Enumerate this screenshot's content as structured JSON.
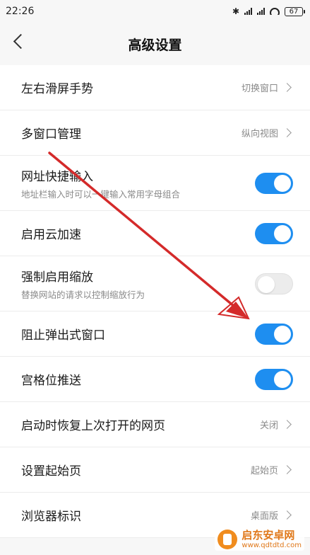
{
  "status_bar": {
    "time": "22:26",
    "battery": "67"
  },
  "header": {
    "title": "高级设置"
  },
  "settings": [
    {
      "label": "左右滑屏手势",
      "value": "切换窗口"
    },
    {
      "label": "多窗口管理",
      "value": "纵向视图"
    },
    {
      "label": "网址快捷输入",
      "desc": "地址栏输入时可以一键输入常用字母组合",
      "toggle": "on"
    },
    {
      "label": "启用云加速",
      "toggle": "on"
    },
    {
      "label": "强制启用缩放",
      "desc": "替换网站的请求以控制缩放行为",
      "toggle": "off"
    },
    {
      "label": "阻止弹出式窗口",
      "toggle": "on"
    },
    {
      "label": "宫格位推送",
      "toggle": "on"
    },
    {
      "label": "启动时恢复上次打开的网页",
      "value": "关闭"
    },
    {
      "label": "设置起始页",
      "value": "起始页"
    },
    {
      "label": "浏览器标识",
      "value": "桌面版"
    }
  ],
  "colors": {
    "accent": "#1e8ef0",
    "annotation_arrow": "#d42a2a"
  },
  "watermark": {
    "title": "启东安卓网",
    "url": "www.qdtdtd.com"
  }
}
